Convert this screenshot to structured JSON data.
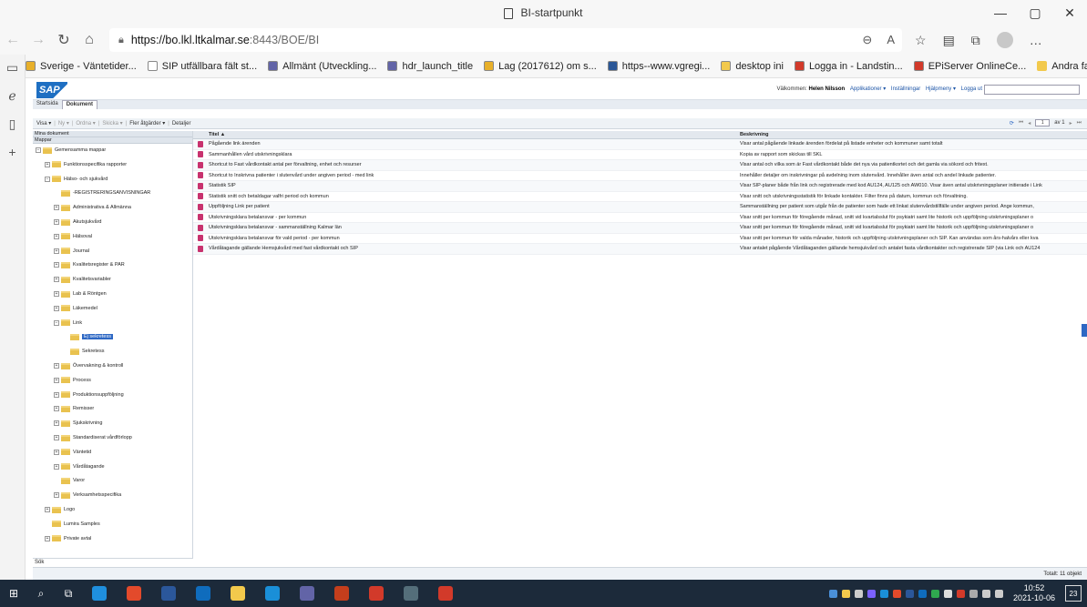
{
  "window": {
    "title": "BI-startpunkt"
  },
  "address": {
    "url_host": "https://bo.lkl.ltkalmar.se",
    "url_path": ":8443/BOE/BI"
  },
  "favorites": [
    {
      "label": "Sverige - Väntetider...",
      "color": "#e8b02a"
    },
    {
      "label": "SIP utfällbara fält st...",
      "color": "#ffffff"
    },
    {
      "label": "Allmänt (Utveckling...",
      "color": "#6264a7"
    },
    {
      "label": "hdr_launch_title",
      "color": "#6264a7"
    },
    {
      "label": "Lag (2017612) om s...",
      "color": "#e8b02a"
    },
    {
      "label": "https--www.vgregi...",
      "color": "#2b5797"
    },
    {
      "label": "desktop ini",
      "color": "#f2c94c"
    },
    {
      "label": "Logga in - Landstin...",
      "color": "#d23a2a"
    },
    {
      "label": "EPiServer OnlineCe...",
      "color": "#d23a2a"
    }
  ],
  "favorites_more": "Andra favoriter",
  "sap": {
    "logo": "SAP",
    "welcome_prefix": "Välkommen:",
    "user": "Helen Nilsson",
    "menu": [
      "Applikationer ▾",
      "Inställningar",
      "Hjälpmeny ▾",
      "Logga ut"
    ],
    "tabs": [
      "Startsida",
      "Dokument"
    ],
    "toolbar": {
      "visa": "Visa ▾",
      "ny": "Ny ▾",
      "ordna": "Ordna ▾",
      "skicka": "Skicka ▾",
      "fler": "Fler åtgärder ▾",
      "detaljer": "Detaljer"
    },
    "pager": {
      "page": "1",
      "of": "av 1"
    },
    "tree_header": "Mina dokument",
    "tree_section": "Mappar",
    "tree": [
      {
        "label": "Gemensamma mappar",
        "depth": 0,
        "plus": "−"
      },
      {
        "label": "Funktionsspecifika rapporter",
        "depth": 1,
        "plus": "+"
      },
      {
        "label": "Hälso- och sjukvård",
        "depth": 1,
        "plus": "−"
      },
      {
        "label": "-REGISTRERINGSANVISNINGAR",
        "depth": 2,
        "plus": ""
      },
      {
        "label": "Administrativa & Allmänna",
        "depth": 2,
        "plus": "+"
      },
      {
        "label": "Akutsjukvård",
        "depth": 2,
        "plus": "+"
      },
      {
        "label": "Hälsoval",
        "depth": 2,
        "plus": "+"
      },
      {
        "label": "Journal",
        "depth": 2,
        "plus": "+"
      },
      {
        "label": "Kvalitetsregister & PAR",
        "depth": 2,
        "plus": "+"
      },
      {
        "label": "Kvalitetsvariabler",
        "depth": 2,
        "plus": "+"
      },
      {
        "label": "Lab & Röntgen",
        "depth": 2,
        "plus": "+"
      },
      {
        "label": "Läkemedel",
        "depth": 2,
        "plus": "+"
      },
      {
        "label": "Link",
        "depth": 2,
        "plus": "−"
      },
      {
        "label": "Ej sekretess",
        "depth": 3,
        "plus": "",
        "selected": true
      },
      {
        "label": "Sekretess",
        "depth": 3,
        "plus": ""
      },
      {
        "label": "Övervakning & kontroll",
        "depth": 2,
        "plus": "+"
      },
      {
        "label": "Process",
        "depth": 2,
        "plus": "+"
      },
      {
        "label": "Produktionsuppföljning",
        "depth": 2,
        "plus": "+"
      },
      {
        "label": "Remisser",
        "depth": 2,
        "plus": "+"
      },
      {
        "label": "Sjukskrivning",
        "depth": 2,
        "plus": "+"
      },
      {
        "label": "Standardiserat vårdförlopp",
        "depth": 2,
        "plus": "+"
      },
      {
        "label": "Väntetid",
        "depth": 2,
        "plus": "+"
      },
      {
        "label": "Vårdåtagande",
        "depth": 2,
        "plus": "+"
      },
      {
        "label": "Varor",
        "depth": 2,
        "plus": ""
      },
      {
        "label": "Verksamhetsspecifika",
        "depth": 2,
        "plus": "+"
      },
      {
        "label": "Logo",
        "depth": 1,
        "plus": "+"
      },
      {
        "label": "Lumira Samples",
        "depth": 1,
        "plus": ""
      },
      {
        "label": "Private avtal",
        "depth": 1,
        "plus": "+"
      }
    ],
    "search_label": "Sök",
    "columns": {
      "title": "Titel ▲",
      "desc": "Beskrivning"
    },
    "documents": [
      {
        "title": "Pågående link ärenden",
        "desc": "Visar antal pågående linkade ärenden fördelat på listade enheter och kommuner samt totalt"
      },
      {
        "title": "Sammanhållen vård utskrivningsklara",
        "desc": "Kopia av rapport som skickas till SKL"
      },
      {
        "title": "Shortcut to Fast vårdkontakt antal per förvaltning, enhet och resurser",
        "desc": "Visar antal och vilka som är Fast vårdkontakt både det nya via patientkortet och det gamla via sökord och fritext."
      },
      {
        "title": "Shortcut to Inskrivna patienter i slutenvård under angiven period - med link",
        "desc": "Innehåller detaljer om inskrivningar på avdelning inom slutenvård. Innehåller även antal och andel linkade patienter."
      },
      {
        "title": "Statistik SIP",
        "desc": "Visar SIP-planer både från link och registrerade med kod AU124, AU125 och AW010. Visar även antal utskrivningsplaner initierade i Link"
      },
      {
        "title": "Statistik snitt och betaldagar valfri period och kommun",
        "desc": "Visar snitt och utskrivningsstatistik för linkade kontakter. Filter finns på datum, kommun och förvaltning."
      },
      {
        "title": "Uppföljning Link per patient",
        "desc": "Sammanställning per patient som utgår från de patienter som hade ett linkat slutenvårdstillfälle under angiven period. Ange kommun,"
      },
      {
        "title": "Utskrivningsklara betalansvar - per kommun",
        "desc": "Visar snitt per kommun för föregående månad, snitt vid kvartalsslut för psykiatri samt lite historik och uppföljning utskrivningsplaner o"
      },
      {
        "title": "Utskrivningsklara betalansvar - sammanställning Kalmar län",
        "desc": "Visar snitt per kommun för föregående månad, snitt vid kvartalsslut för psykiatri samt lite historik och uppföljning utskrivningsplaner o"
      },
      {
        "title": "Utskrivningsklara betalansvar för vald period - per kommun",
        "desc": "Visar snitt per kommun för valda månader, historik och uppföljning utskrivningsplaner och SIP. Kan användas som års-halvårs eller kva"
      },
      {
        "title": "Vårdåtagande gällande Hemsjukvård med fast vårdkontakt och SIP",
        "desc": "Visar antalet pågående Vårdåtaganden gällande hemsjukvård och antalet fasta vårdkontakter och registrerade SIP (via Link och AU124"
      }
    ],
    "total": "Totalt: 11 objekt"
  },
  "taskbar": {
    "time": "10:52",
    "date": "2021-10-06",
    "notif": "23"
  }
}
